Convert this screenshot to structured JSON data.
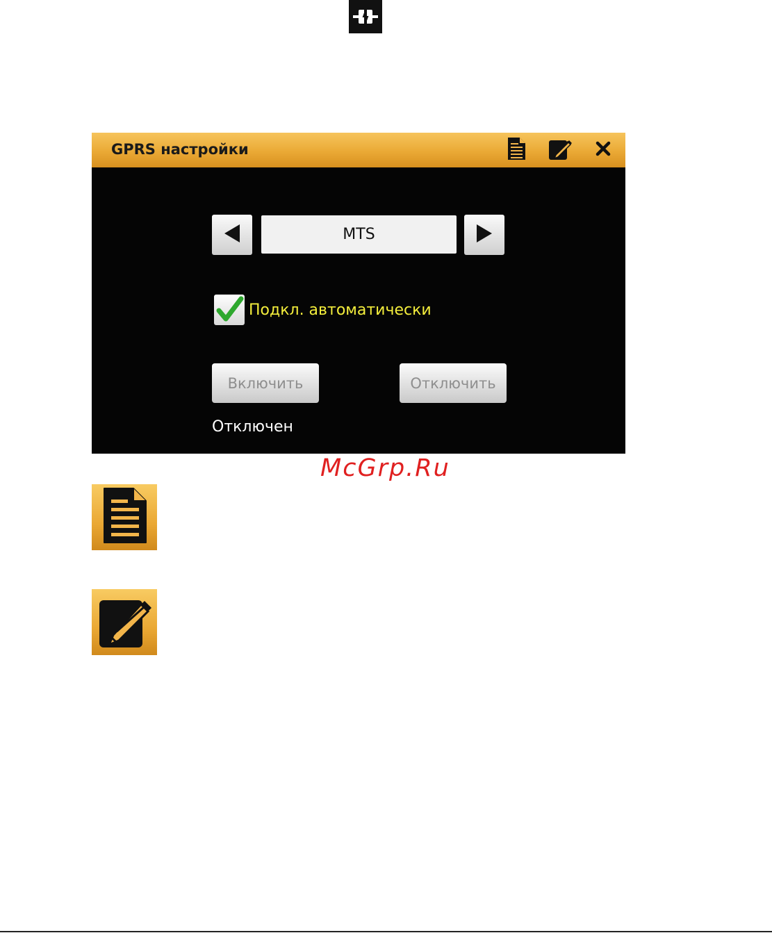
{
  "top_icon": {
    "icon": "connection-plug-icon"
  },
  "window": {
    "title": "GPRS настройки",
    "toolbar": {
      "document_icon": "document-icon",
      "edit_icon": "edit-pencil-icon",
      "close_icon": "close-icon"
    },
    "operator_selector": {
      "prev_icon": "arrow-left-icon",
      "value": "MTS",
      "next_icon": "arrow-right-icon"
    },
    "auto_connect": {
      "checked": true,
      "label": "Подкл. автоматически"
    },
    "buttons": {
      "enable_label": "Включить",
      "disable_label": "Отключить"
    },
    "status": "Отключен"
  },
  "watermark": "McGrp.Ru",
  "legend_icons": [
    {
      "icon": "document-icon"
    },
    {
      "icon": "edit-pencil-icon"
    }
  ],
  "colors": {
    "titlebar_accent": "#eaa935",
    "window_background": "#050505",
    "checkbox_label": "#f4ee3c",
    "checkmark": "#2ea82e",
    "watermark": "#e02020"
  }
}
